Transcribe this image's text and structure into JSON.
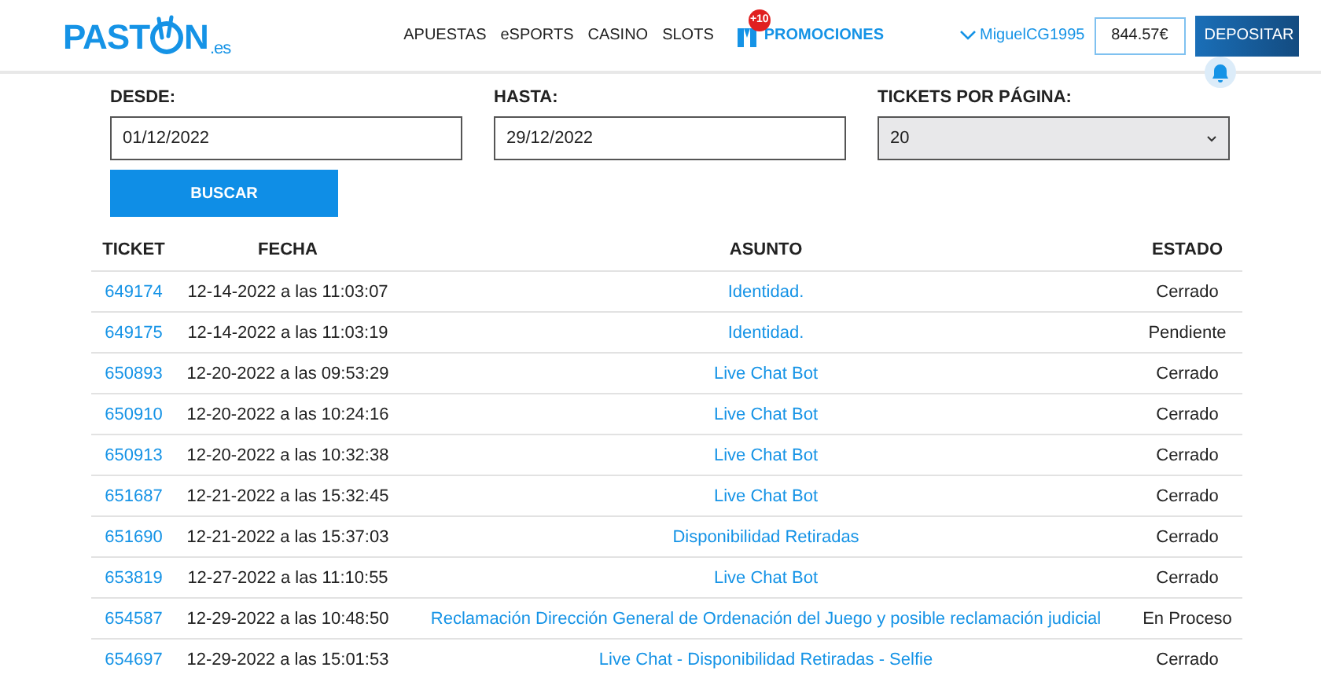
{
  "header": {
    "logo": {
      "before": "PAST",
      "after": "N",
      "suffix": ".es"
    },
    "nav": [
      "APUESTAS",
      "eSPORTS",
      "CASINO",
      "SLOTS"
    ],
    "promo": {
      "label": "PROMOCIONES",
      "badge": "+10"
    },
    "user": "MiguelCG1995",
    "balance": "844.57€",
    "deposit": "DEPOSITAR"
  },
  "filters": {
    "fields": [
      {
        "label": "DESDE:",
        "value": "01/12/2022",
        "kind": "text"
      },
      {
        "label": "HASTA:",
        "value": "29/12/2022",
        "kind": "text"
      },
      {
        "label": "TICKETS POR PÁGINA:",
        "value": "20",
        "kind": "select"
      }
    ],
    "search": "BUSCAR"
  },
  "table": {
    "columns": [
      "TICKET",
      "FECHA",
      "ASUNTO",
      "ESTADO"
    ],
    "rows": [
      [
        "649174",
        "12-14-2022 a las 11:03:07",
        "Identidad.",
        "Cerrado"
      ],
      [
        "649175",
        "12-14-2022 a las 11:03:19",
        "Identidad.",
        "Pendiente"
      ],
      [
        "650893",
        "12-20-2022 a las 09:53:29",
        "Live Chat Bot",
        "Cerrado"
      ],
      [
        "650910",
        "12-20-2022 a las 10:24:16",
        "Live Chat Bot",
        "Cerrado"
      ],
      [
        "650913",
        "12-20-2022 a las 10:32:38",
        "Live Chat Bot",
        "Cerrado"
      ],
      [
        "651687",
        "12-21-2022 a las 15:32:45",
        "Live Chat Bot",
        "Cerrado"
      ],
      [
        "651690",
        "12-21-2022 a las 15:37:03",
        "Disponibilidad Retiradas",
        "Cerrado"
      ],
      [
        "653819",
        "12-27-2022 a las 11:10:55",
        "Live Chat Bot",
        "Cerrado"
      ],
      [
        "654587",
        "12-29-2022 a las 10:48:50",
        "Reclamación Dirección General de Ordenación del Juego y posible reclamación judicial",
        "En Proceso"
      ],
      [
        "654697",
        "12-29-2022 a las 15:01:53",
        "Live Chat - Disponibilidad Retiradas - Selfie",
        "Cerrado"
      ]
    ]
  }
}
